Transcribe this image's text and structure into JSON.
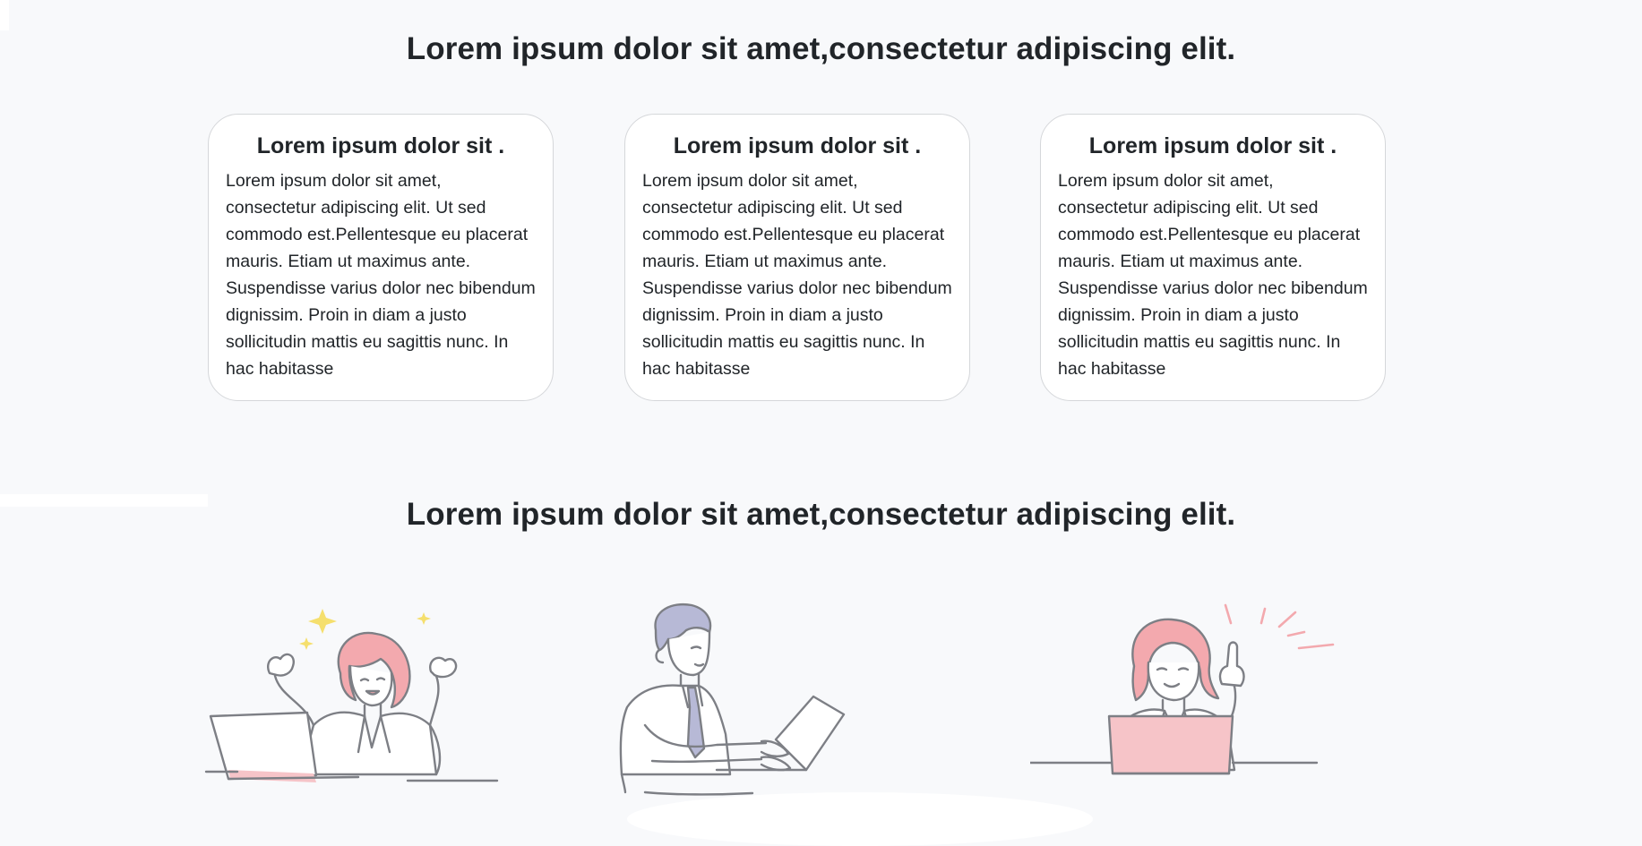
{
  "sections": [
    {
      "title": "Lorem ipsum dolor sit amet,consectetur adipiscing elit."
    },
    {
      "title": "Lorem ipsum dolor sit amet,consectetur adipiscing elit."
    }
  ],
  "cards": [
    {
      "title": "Lorem ipsum dolor sit .",
      "text": "Lorem ipsum dolor sit amet, consectetur adipiscing elit. Ut sed commodo est.Pellentesque eu placerat mauris. Etiam ut maximus ante. Suspendisse varius dolor nec bibendum dignissim. Proin in diam a justo sollicitudin mattis eu sagittis nunc. In hac habitasse"
    },
    {
      "title": "Lorem ipsum dolor sit .",
      "text": "Lorem ipsum dolor sit amet, consectetur adipiscing elit. Ut sed commodo est.Pellentesque eu placerat mauris. Etiam ut maximus ante. Suspendisse varius dolor nec bibendum dignissim. Proin in diam a justo sollicitudin mattis eu sagittis nunc. In hac habitasse"
    },
    {
      "title": "Lorem ipsum dolor sit .",
      "text": "Lorem ipsum dolor sit amet, consectetur adipiscing elit. Ut sed commodo est.Pellentesque eu placerat mauris. Etiam ut maximus ante. Suspendisse varius dolor nec bibendum dignissim. Proin in diam a justo sollicitudin mattis eu sagittis nunc. In hac habitasse"
    }
  ],
  "illustrations": [
    {
      "icon": "celebrating-woman-laptop-illustration"
    },
    {
      "icon": "man-typing-laptop-illustration"
    },
    {
      "icon": "woman-idea-laptop-illustration"
    }
  ],
  "colors": {
    "background": "#f8f9fb",
    "card_background": "#ffffff",
    "card_border": "#d5d7da",
    "text": "#212529",
    "line_art": "#7d7f85",
    "accent_pink": "#f6c4c8",
    "accent_hair_pink": "#f3a9ae",
    "accent_yellow": "#f5df6d",
    "accent_lavender": "#b7b9d6"
  }
}
